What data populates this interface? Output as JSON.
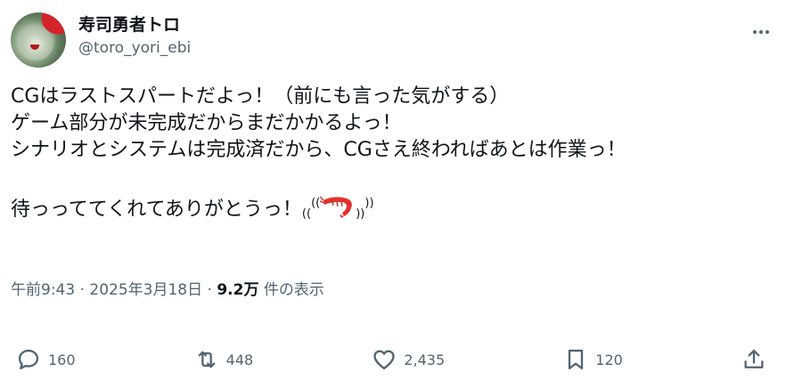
{
  "author": {
    "display_name": "寿司勇者トロ",
    "handle": "@toro_yori_ebi"
  },
  "post": {
    "lines": [
      "CGはラストスパートだよっ！（前にも言った気がする）",
      "ゲーム部分が未完成だからまだかかるよっ！",
      "シナリオとシステムは完成済だから、CGさえ終わればあとは作業っ！",
      "",
      "待っっててくれてありがとうっ！"
    ],
    "emoji_left": "((",
    "emoji_mid": "((",
    "emoji_right1": "))",
    "emoji_right2": "))",
    "emoji_name": "shrimp-icon"
  },
  "meta": {
    "time": "午前9:43",
    "separator": " · ",
    "date": "2025年3月18日",
    "views_count": "9.2万",
    "views_label": "件の表示"
  },
  "actions": {
    "replies": "160",
    "reposts": "448",
    "likes": "2,435",
    "bookmarks": "120"
  },
  "colors": {
    "text": "#0f1419",
    "secondary": "#536471",
    "shrimp": "#e0322e"
  }
}
